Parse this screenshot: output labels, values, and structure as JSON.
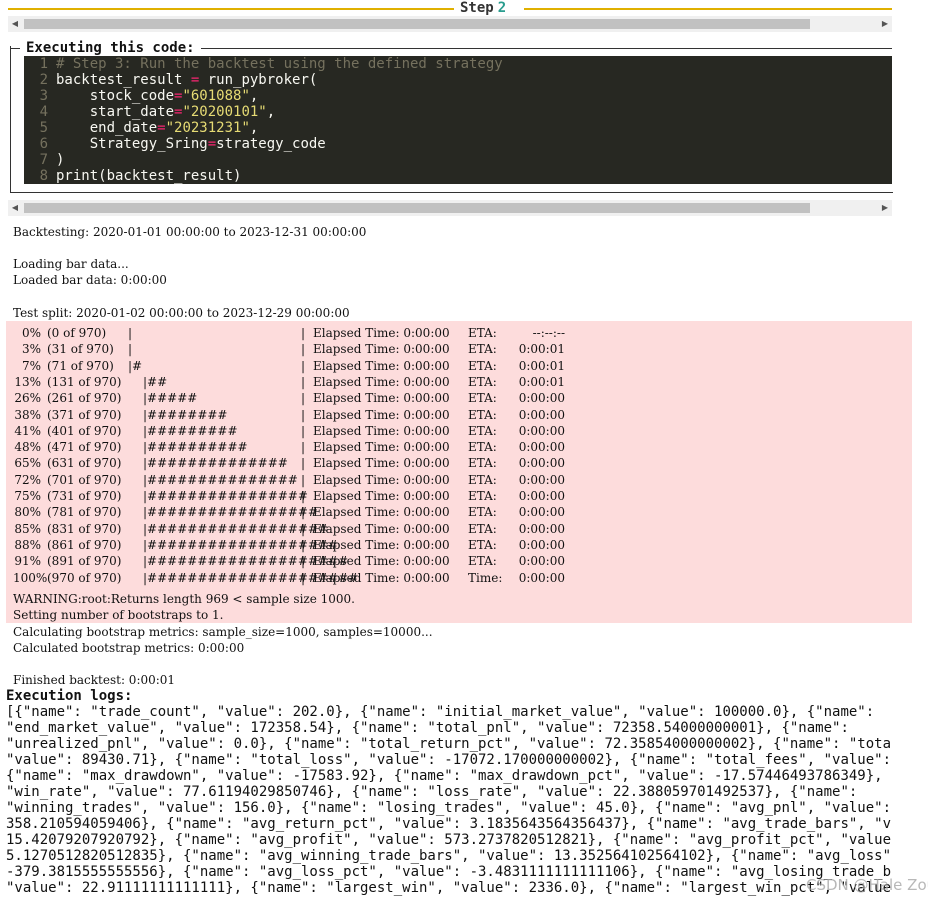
{
  "step": {
    "label": "Step",
    "number": "2"
  },
  "exec": {
    "label": "Executing this code:"
  },
  "code_lines": [
    {
      "n": "1",
      "html_parts": [
        {
          "t": "# Step 3: Run the backtest using the defined strategy",
          "c": "cm"
        }
      ]
    },
    {
      "n": "2",
      "html_parts": [
        {
          "t": "backtest_result ",
          "c": ""
        },
        {
          "t": "=",
          "c": "op"
        },
        {
          "t": " run_pybroker(",
          "c": ""
        }
      ]
    },
    {
      "n": "3",
      "html_parts": [
        {
          "t": "    stock_code",
          "c": ""
        },
        {
          "t": "=",
          "c": "op"
        },
        {
          "t": "\"601088\"",
          "c": "str"
        },
        {
          "t": ",",
          "c": ""
        }
      ]
    },
    {
      "n": "4",
      "html_parts": [
        {
          "t": "    start_date",
          "c": ""
        },
        {
          "t": "=",
          "c": "op"
        },
        {
          "t": "\"20200101\"",
          "c": "str"
        },
        {
          "t": ",",
          "c": ""
        }
      ]
    },
    {
      "n": "5",
      "html_parts": [
        {
          "t": "    end_date",
          "c": ""
        },
        {
          "t": "=",
          "c": "op"
        },
        {
          "t": "\"20231231\"",
          "c": "str"
        },
        {
          "t": ",",
          "c": ""
        }
      ]
    },
    {
      "n": "6",
      "html_parts": [
        {
          "t": "    Strategy_Sring",
          "c": ""
        },
        {
          "t": "=",
          "c": "op"
        },
        {
          "t": "strategy_code",
          "c": ""
        }
      ]
    },
    {
      "n": "7",
      "html_parts": [
        {
          "t": ")",
          "c": ""
        }
      ]
    },
    {
      "n": "8",
      "html_parts": [
        {
          "t": "print(backtest_result)",
          "c": ""
        }
      ]
    }
  ],
  "output": {
    "backtesting": "Backtesting: 2020-01-01 00:00:00 to 2023-12-31 00:00:00",
    "loading": "Loading bar data...",
    "loaded": "Loaded bar data: 0:00:00",
    "test_split": "Test split: 2020-01-02 00:00:00 to 2023-12-29 00:00:00",
    "warning": "WARNING:root:Returns length 969 < sample size 1000.",
    "setting": "Setting number of bootstraps to 1.",
    "calculating": "Calculating bootstrap metrics: sample_size=1000, samples=10000...",
    "calculated": "Calculated bootstrap metrics: 0:00:00",
    "finished": "Finished backtest: 0:00:01"
  },
  "progress": [
    {
      "pct": "0%",
      "count": "(0 of 970)",
      "bar": "",
      "elapsed": "Elapsed Time: 0:00:00",
      "eta_label": "ETA:",
      "eta": "--:--:--"
    },
    {
      "pct": "3%",
      "count": "(31 of 970)",
      "bar": "",
      "elapsed": "Elapsed Time: 0:00:00",
      "eta_label": "ETA:",
      "eta": "0:00:01"
    },
    {
      "pct": "7%",
      "count": "(71 of 970)",
      "bar": "#",
      "elapsed": "Elapsed Time: 0:00:00",
      "eta_label": "ETA:",
      "eta": "0:00:01"
    },
    {
      "pct": "13%",
      "count": "(131 of 970)",
      "bar": "##",
      "elapsed": "Elapsed Time: 0:00:00",
      "eta_label": "ETA:",
      "eta": "0:00:01"
    },
    {
      "pct": "26%",
      "count": "(261 of 970)",
      "bar": "#####",
      "elapsed": "Elapsed Time: 0:00:00",
      "eta_label": "ETA:",
      "eta": "0:00:00"
    },
    {
      "pct": "38%",
      "count": "(371 of 970)",
      "bar": "########",
      "elapsed": "Elapsed Time: 0:00:00",
      "eta_label": "ETA:",
      "eta": "0:00:00"
    },
    {
      "pct": "41%",
      "count": "(401 of 970)",
      "bar": "#########",
      "elapsed": "Elapsed Time: 0:00:00",
      "eta_label": "ETA:",
      "eta": "0:00:00"
    },
    {
      "pct": "48%",
      "count": "(471 of 970)",
      "bar": "##########",
      "elapsed": "Elapsed Time: 0:00:00",
      "eta_label": "ETA:",
      "eta": "0:00:00"
    },
    {
      "pct": "65%",
      "count": "(631 of 970)",
      "bar": "##############",
      "elapsed": "Elapsed Time: 0:00:00",
      "eta_label": "ETA:",
      "eta": "0:00:00"
    },
    {
      "pct": "72%",
      "count": "(701 of 970)",
      "bar": "###############",
      "elapsed": "Elapsed Time: 0:00:00",
      "eta_label": "ETA:",
      "eta": "0:00:00"
    },
    {
      "pct": "75%",
      "count": "(731 of 970)",
      "bar": "################",
      "elapsed": "Elapsed Time: 0:00:00",
      "eta_label": "ETA:",
      "eta": "0:00:00"
    },
    {
      "pct": "80%",
      "count": "(781 of 970)",
      "bar": "#################",
      "elapsed": "Elapsed Time: 0:00:00",
      "eta_label": "ETA:",
      "eta": "0:00:00"
    },
    {
      "pct": "85%",
      "count": "(831 of 970)",
      "bar": "##################",
      "elapsed": "Elapsed Time: 0:00:00",
      "eta_label": "ETA:",
      "eta": "0:00:00"
    },
    {
      "pct": "88%",
      "count": "(861 of 970)",
      "bar": "###################",
      "elapsed": "Elapsed Time: 0:00:00",
      "eta_label": "ETA:",
      "eta": "0:00:00"
    },
    {
      "pct": "91%",
      "count": "(891 of 970)",
      "bar": "####################",
      "elapsed": "Elapsed Time: 0:00:00",
      "eta_label": "ETA:",
      "eta": "0:00:00"
    },
    {
      "pct": "100%",
      "count": "(970 of 970)",
      "bar": "#####################",
      "elapsed": "Elapsed Time: 0:00:00",
      "eta_label": "Time:",
      "eta": "0:00:00"
    }
  ],
  "logs": {
    "title": "Execution logs:",
    "lines": [
      "[{\"name\": \"trade_count\", \"value\": 202.0}, {\"name\": \"initial_market_value\", \"value\": 100000.0}, {\"name\":",
      "\"end_market_value\", \"value\": 172358.54}, {\"name\": \"total_pnl\", \"value\": 72358.54000000001}, {\"name\":",
      "\"unrealized_pnl\", \"value\": 0.0}, {\"name\": \"total_return_pct\", \"value\": 72.35854000000002}, {\"name\": \"tota",
      "\"value\": 89430.71}, {\"name\": \"total_loss\", \"value\": -17072.170000000002}, {\"name\": \"total_fees\", \"value\":",
      "{\"name\": \"max_drawdown\", \"value\": -17583.92}, {\"name\": \"max_drawdown_pct\", \"value\": -17.57446493786349},",
      "\"win_rate\", \"value\": 77.61194029850746}, {\"name\": \"loss_rate\", \"value\": 22.388059701492537}, {\"name\":",
      "\"winning_trades\", \"value\": 156.0}, {\"name\": \"losing_trades\", \"value\": 45.0}, {\"name\": \"avg_pnl\", \"value\":",
      "358.210594059406}, {\"name\": \"avg_return_pct\", \"value\": 3.1835643564356437}, {\"name\": \"avg_trade_bars\", \"v",
      "15.42079207920792}, {\"name\": \"avg_profit\", \"value\": 573.2737820512821}, {\"name\": \"avg_profit_pct\", \"value",
      "5.1270512820512835}, {\"name\": \"avg_winning_trade_bars\", \"value\": 13.352564102564102}, {\"name\": \"avg_loss\"",
      "-379.3815555555556}, {\"name\": \"avg_loss_pct\", \"value\": -3.4831111111111106}, {\"name\": \"avg_losing_trade_b",
      "\"value\": 22.91111111111111}, {\"name\": \"largest_win\", \"value\": 2336.0}, {\"name\": \"largest_win_pct\", \"value"
    ]
  },
  "watermark": "CSDN @Hale Zou"
}
